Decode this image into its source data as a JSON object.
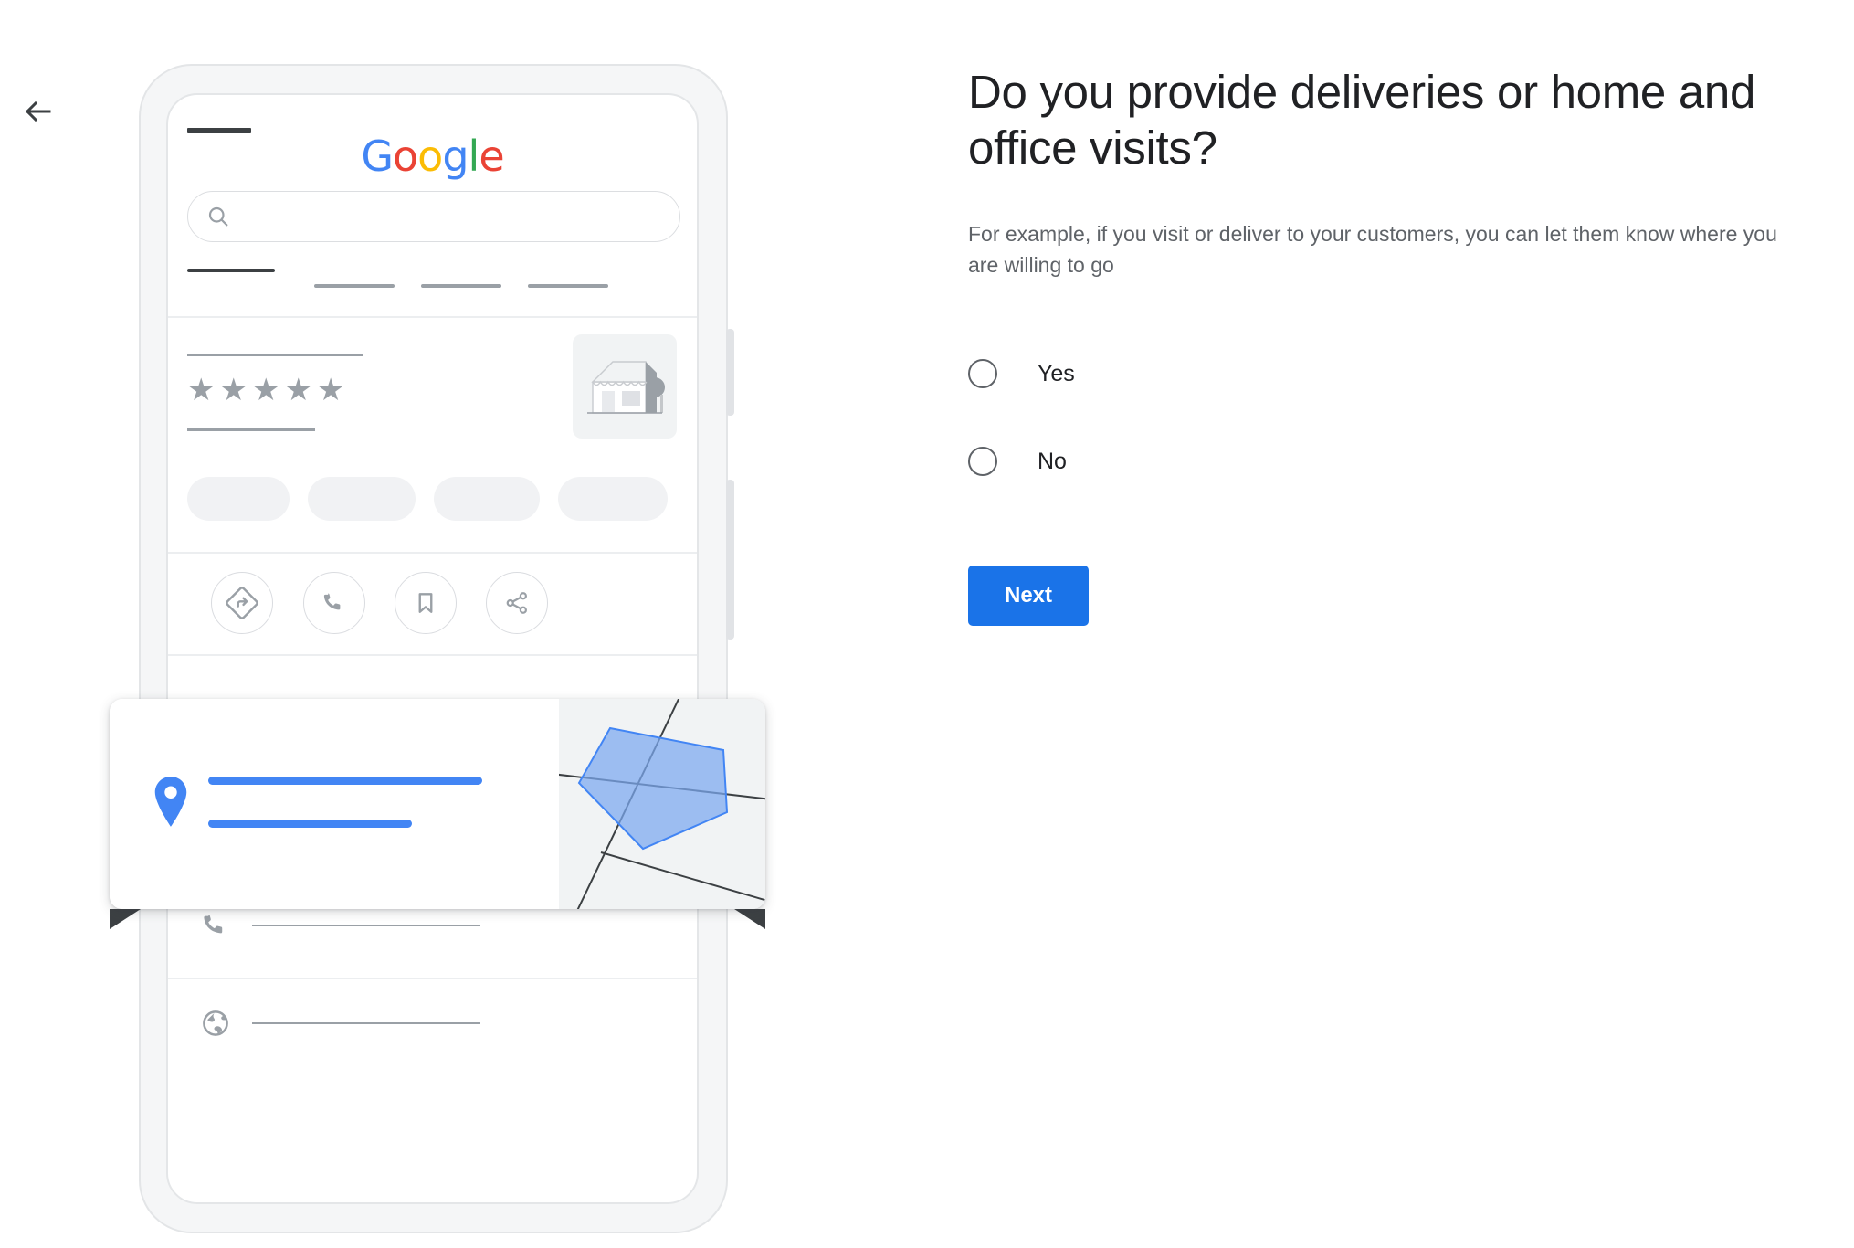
{
  "nav": {
    "back_icon": "arrow-left-icon",
    "back_label": "Back"
  },
  "question": {
    "headline": "Do you provide deliveries or home and office visits?",
    "subtext": "For example, if you visit or deliver to your customers, you can let them know where you are willing to go",
    "options": [
      {
        "label": "Yes",
        "value": "yes",
        "selected": false
      },
      {
        "label": "No",
        "value": "no",
        "selected": false
      }
    ],
    "next_label": "Next"
  },
  "colors": {
    "accent_blue": "#1a73e8",
    "map_area_blue": "#7ba7f0",
    "banner_blue": "#aec8f8",
    "text_primary": "#202124",
    "text_secondary": "#5f6368",
    "placeholder_gray": "#9aa0a6",
    "chip_gray": "#f1f2f4",
    "google_blue": "#4285F4",
    "google_red": "#EA4335",
    "google_yellow": "#FBBC05",
    "google_green": "#34A853"
  },
  "illustration": {
    "name": "phone-mockup-business-profile",
    "logo": {
      "name": "google-logo",
      "letters": [
        "G",
        "o",
        "o",
        "g",
        "l",
        "e"
      ]
    },
    "search": {
      "icon": "search-icon",
      "placeholder": ""
    },
    "tabs": [
      {
        "name": "tab-active",
        "active": true
      },
      {
        "name": "tab-2",
        "active": false
      },
      {
        "name": "tab-3",
        "active": false
      },
      {
        "name": "tab-4",
        "active": false
      }
    ],
    "business": {
      "title_placeholder": "",
      "rating_stars": "★★★★★",
      "rating_count": 5,
      "subtitle_placeholder": "",
      "thumbnail_icon": "storefront-icon"
    },
    "chips": [
      {
        "name": "chip-1"
      },
      {
        "name": "chip-2"
      },
      {
        "name": "chip-3"
      },
      {
        "name": "chip-4"
      }
    ],
    "actions": [
      {
        "name": "directions-icon"
      },
      {
        "name": "call-icon"
      },
      {
        "name": "save-bookmark-icon"
      },
      {
        "name": "share-icon"
      }
    ],
    "service_area_card": {
      "name": "service-area-card",
      "pin_icon": "location-pin-icon",
      "line1_placeholder": "",
      "line2_placeholder": "",
      "map": {
        "name": "service-area-map",
        "shape": "pentagon",
        "roads": 3
      }
    },
    "info_rows": [
      {
        "name": "hours-row",
        "icon": "clock-icon"
      },
      {
        "name": "phone-row",
        "icon": "phone-icon"
      },
      {
        "name": "website-row",
        "icon": "globe-icon"
      }
    ]
  }
}
